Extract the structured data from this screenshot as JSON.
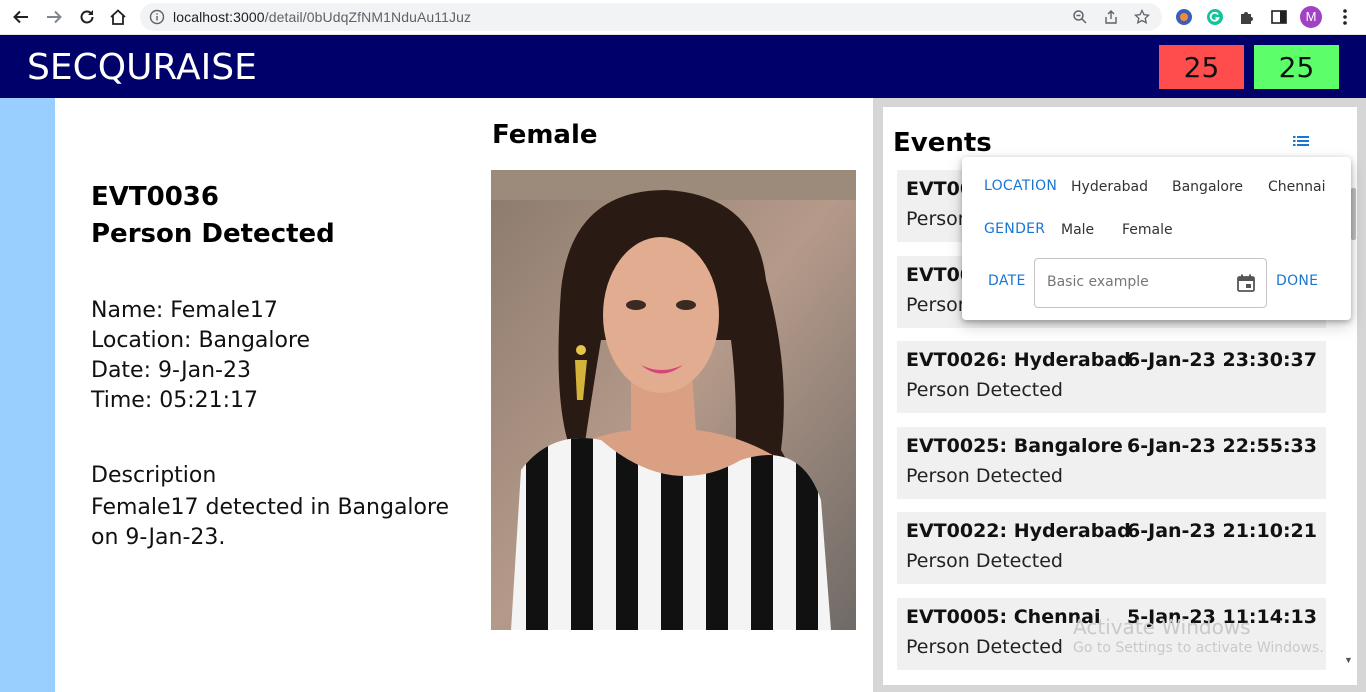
{
  "browser": {
    "url_host": "localhost:3000",
    "url_path": "/detail/0bUdqZfNM1NduAu11Juz",
    "profile_initial": "M"
  },
  "header": {
    "brand": "SECQURAISE",
    "count_red": "25",
    "count_green": "25",
    "colors": {
      "bar": "#00006a",
      "red": "#ff4d4d",
      "green": "#5cff6a"
    }
  },
  "detail": {
    "event_id": "EVT0036",
    "event_title": "Person Detected",
    "name_line": "Name: Female17",
    "location_line": "Location: Bangalore",
    "date_line": "Date: 9-Jan-23",
    "time_line": "Time: 05:21:17",
    "description_heading": "Description",
    "description_text": "Female17 detected in Bangalore on 9-Jan-23.",
    "gender": "Female"
  },
  "events_panel": {
    "title": "Events",
    "items": [
      {
        "head": "EVT00",
        "time": "",
        "sub": "Person"
      },
      {
        "head": "EVT00",
        "time": "",
        "sub": "Person"
      },
      {
        "head": "EVT0026: Hyderabad",
        "time": "6-Jan-23 23:30:37",
        "sub": "Person Detected"
      },
      {
        "head": "EVT0025: Bangalore",
        "time": "6-Jan-23 22:55:33",
        "sub": "Person Detected"
      },
      {
        "head": "EVT0022: Hyderabad",
        "time": "6-Jan-23 21:10:21",
        "sub": "Person Detected"
      },
      {
        "head": "EVT0005: Chennai",
        "time": "5-Jan-23 11:14:13",
        "sub": "Person Detected"
      }
    ]
  },
  "filter": {
    "location_label": "LOCATION",
    "locations": [
      "Hyderabad",
      "Bangalore",
      "Chennai"
    ],
    "gender_label": "GENDER",
    "genders": [
      "Male",
      "Female"
    ],
    "date_label": "DATE",
    "date_placeholder": "Basic example",
    "done_label": "DONE",
    "accent": "#1976d2"
  },
  "watermark": {
    "line1": "Activate Windows",
    "line2": "Go to Settings to activate Windows."
  }
}
